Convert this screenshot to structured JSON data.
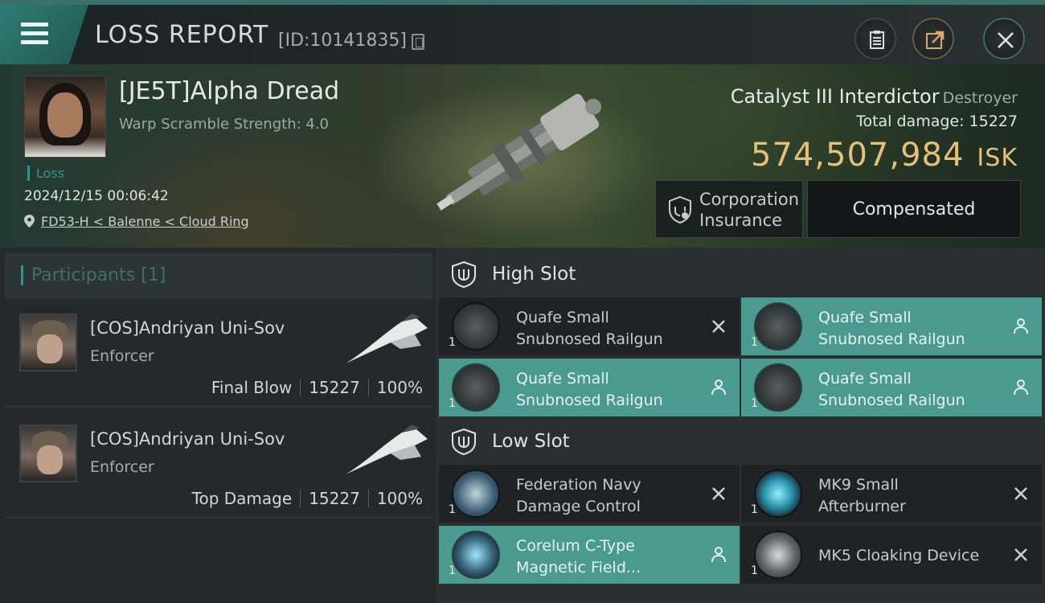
{
  "header": {
    "title": "LOSS REPORT",
    "report_id": "[ID:10141835]"
  },
  "victim": {
    "name": "[JE5T]Alpha Dread",
    "stat": "Warp Scramble Strength: 4.0",
    "status": "Loss",
    "date": "2024/12/15 00:06:42",
    "location": "FD53-H < Balenne < Cloud Ring"
  },
  "ship": {
    "name": "Catalyst III Interdictor",
    "class": "Destroyer",
    "total_damage_label": "Total damage:",
    "total_damage": "15227",
    "value": "574,507,984",
    "unit": "ISK"
  },
  "buttons": {
    "insurance": "Corporation\nInsurance",
    "insurance_line1": "Corporation",
    "insurance_line2": "Insurance",
    "compensated": "Compensated"
  },
  "participants": {
    "label": "Participants [1]",
    "items": [
      {
        "name": "[COS]Andriyan Uni-Sov",
        "ship": "Enforcer",
        "role": "Final Blow",
        "damage": "15227",
        "percent": "100%"
      },
      {
        "name": "[COS]Andriyan Uni-Sov",
        "ship": "Enforcer",
        "role": "Top Damage",
        "damage": "15227",
        "percent": "100%"
      }
    ]
  },
  "slots": {
    "high": {
      "label": "High Slot",
      "modules": [
        {
          "line1": "Quafe Small",
          "line2": "Snubnosed Railgun",
          "qty": "1",
          "state": "destroyed"
        },
        {
          "line1": "Quafe Small",
          "line2": "Snubnosed Railgun",
          "qty": "1",
          "state": "dropped"
        },
        {
          "line1": "Quafe Small",
          "line2": "Snubnosed Railgun",
          "qty": "1",
          "state": "dropped"
        },
        {
          "line1": "Quafe Small",
          "line2": "Snubnosed Railgun",
          "qty": "1",
          "state": "dropped"
        }
      ]
    },
    "low": {
      "label": "Low Slot",
      "modules": [
        {
          "line1": "Federation Navy",
          "line2": "Damage Control",
          "qty": "1",
          "state": "destroyed"
        },
        {
          "line1": "MK9 Small",
          "line2": "Afterburner",
          "qty": "1",
          "state": "destroyed"
        },
        {
          "line1": "Corelum C-Type",
          "line2": "Magnetic Field...",
          "qty": "1",
          "state": "dropped"
        },
        {
          "line1": "MK5 Cloaking Device",
          "line2": "",
          "qty": "1",
          "state": "destroyed"
        }
      ]
    }
  },
  "colors": {
    "accent": "#3c8f86",
    "fitted": "#4b9a90",
    "isk": "#e4c07a"
  }
}
